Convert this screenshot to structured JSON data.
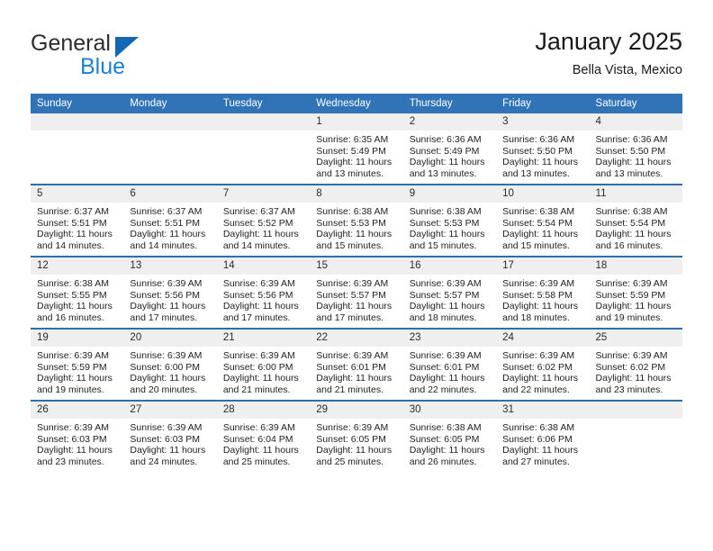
{
  "brand": {
    "name_top": "General",
    "name_bottom": "Blue",
    "triangle_color": "#1268b3",
    "blue_text_color": "#1c7fd4"
  },
  "header": {
    "title": "January 2025",
    "subtitle": "Bella Vista, Mexico"
  },
  "colors": {
    "header_row_bg": "#3073b6",
    "header_row_text": "#ffffff",
    "week_separator": "#2d6fae",
    "day_number_bg": "#efefef",
    "page_bg": "#ffffff"
  },
  "calendar": {
    "weekday_headers": [
      "Sunday",
      "Monday",
      "Tuesday",
      "Wednesday",
      "Thursday",
      "Friday",
      "Saturday"
    ],
    "weeks": [
      [
        {
          "day": "",
          "sunrise": "",
          "sunset": "",
          "daylight_line1": "",
          "daylight_line2": ""
        },
        {
          "day": "",
          "sunrise": "",
          "sunset": "",
          "daylight_line1": "",
          "daylight_line2": ""
        },
        {
          "day": "",
          "sunrise": "",
          "sunset": "",
          "daylight_line1": "",
          "daylight_line2": ""
        },
        {
          "day": "1",
          "sunrise": "Sunrise: 6:35 AM",
          "sunset": "Sunset: 5:49 PM",
          "daylight_line1": "Daylight: 11 hours",
          "daylight_line2": "and 13 minutes."
        },
        {
          "day": "2",
          "sunrise": "Sunrise: 6:36 AM",
          "sunset": "Sunset: 5:49 PM",
          "daylight_line1": "Daylight: 11 hours",
          "daylight_line2": "and 13 minutes."
        },
        {
          "day": "3",
          "sunrise": "Sunrise: 6:36 AM",
          "sunset": "Sunset: 5:50 PM",
          "daylight_line1": "Daylight: 11 hours",
          "daylight_line2": "and 13 minutes."
        },
        {
          "day": "4",
          "sunrise": "Sunrise: 6:36 AM",
          "sunset": "Sunset: 5:50 PM",
          "daylight_line1": "Daylight: 11 hours",
          "daylight_line2": "and 13 minutes."
        }
      ],
      [
        {
          "day": "5",
          "sunrise": "Sunrise: 6:37 AM",
          "sunset": "Sunset: 5:51 PM",
          "daylight_line1": "Daylight: 11 hours",
          "daylight_line2": "and 14 minutes."
        },
        {
          "day": "6",
          "sunrise": "Sunrise: 6:37 AM",
          "sunset": "Sunset: 5:51 PM",
          "daylight_line1": "Daylight: 11 hours",
          "daylight_line2": "and 14 minutes."
        },
        {
          "day": "7",
          "sunrise": "Sunrise: 6:37 AM",
          "sunset": "Sunset: 5:52 PM",
          "daylight_line1": "Daylight: 11 hours",
          "daylight_line2": "and 14 minutes."
        },
        {
          "day": "8",
          "sunrise": "Sunrise: 6:38 AM",
          "sunset": "Sunset: 5:53 PM",
          "daylight_line1": "Daylight: 11 hours",
          "daylight_line2": "and 15 minutes."
        },
        {
          "day": "9",
          "sunrise": "Sunrise: 6:38 AM",
          "sunset": "Sunset: 5:53 PM",
          "daylight_line1": "Daylight: 11 hours",
          "daylight_line2": "and 15 minutes."
        },
        {
          "day": "10",
          "sunrise": "Sunrise: 6:38 AM",
          "sunset": "Sunset: 5:54 PM",
          "daylight_line1": "Daylight: 11 hours",
          "daylight_line2": "and 15 minutes."
        },
        {
          "day": "11",
          "sunrise": "Sunrise: 6:38 AM",
          "sunset": "Sunset: 5:54 PM",
          "daylight_line1": "Daylight: 11 hours",
          "daylight_line2": "and 16 minutes."
        }
      ],
      [
        {
          "day": "12",
          "sunrise": "Sunrise: 6:38 AM",
          "sunset": "Sunset: 5:55 PM",
          "daylight_line1": "Daylight: 11 hours",
          "daylight_line2": "and 16 minutes."
        },
        {
          "day": "13",
          "sunrise": "Sunrise: 6:39 AM",
          "sunset": "Sunset: 5:56 PM",
          "daylight_line1": "Daylight: 11 hours",
          "daylight_line2": "and 17 minutes."
        },
        {
          "day": "14",
          "sunrise": "Sunrise: 6:39 AM",
          "sunset": "Sunset: 5:56 PM",
          "daylight_line1": "Daylight: 11 hours",
          "daylight_line2": "and 17 minutes."
        },
        {
          "day": "15",
          "sunrise": "Sunrise: 6:39 AM",
          "sunset": "Sunset: 5:57 PM",
          "daylight_line1": "Daylight: 11 hours",
          "daylight_line2": "and 17 minutes."
        },
        {
          "day": "16",
          "sunrise": "Sunrise: 6:39 AM",
          "sunset": "Sunset: 5:57 PM",
          "daylight_line1": "Daylight: 11 hours",
          "daylight_line2": "and 18 minutes."
        },
        {
          "day": "17",
          "sunrise": "Sunrise: 6:39 AM",
          "sunset": "Sunset: 5:58 PM",
          "daylight_line1": "Daylight: 11 hours",
          "daylight_line2": "and 18 minutes."
        },
        {
          "day": "18",
          "sunrise": "Sunrise: 6:39 AM",
          "sunset": "Sunset: 5:59 PM",
          "daylight_line1": "Daylight: 11 hours",
          "daylight_line2": "and 19 minutes."
        }
      ],
      [
        {
          "day": "19",
          "sunrise": "Sunrise: 6:39 AM",
          "sunset": "Sunset: 5:59 PM",
          "daylight_line1": "Daylight: 11 hours",
          "daylight_line2": "and 19 minutes."
        },
        {
          "day": "20",
          "sunrise": "Sunrise: 6:39 AM",
          "sunset": "Sunset: 6:00 PM",
          "daylight_line1": "Daylight: 11 hours",
          "daylight_line2": "and 20 minutes."
        },
        {
          "day": "21",
          "sunrise": "Sunrise: 6:39 AM",
          "sunset": "Sunset: 6:00 PM",
          "daylight_line1": "Daylight: 11 hours",
          "daylight_line2": "and 21 minutes."
        },
        {
          "day": "22",
          "sunrise": "Sunrise: 6:39 AM",
          "sunset": "Sunset: 6:01 PM",
          "daylight_line1": "Daylight: 11 hours",
          "daylight_line2": "and 21 minutes."
        },
        {
          "day": "23",
          "sunrise": "Sunrise: 6:39 AM",
          "sunset": "Sunset: 6:01 PM",
          "daylight_line1": "Daylight: 11 hours",
          "daylight_line2": "and 22 minutes."
        },
        {
          "day": "24",
          "sunrise": "Sunrise: 6:39 AM",
          "sunset": "Sunset: 6:02 PM",
          "daylight_line1": "Daylight: 11 hours",
          "daylight_line2": "and 22 minutes."
        },
        {
          "day": "25",
          "sunrise": "Sunrise: 6:39 AM",
          "sunset": "Sunset: 6:02 PM",
          "daylight_line1": "Daylight: 11 hours",
          "daylight_line2": "and 23 minutes."
        }
      ],
      [
        {
          "day": "26",
          "sunrise": "Sunrise: 6:39 AM",
          "sunset": "Sunset: 6:03 PM",
          "daylight_line1": "Daylight: 11 hours",
          "daylight_line2": "and 23 minutes."
        },
        {
          "day": "27",
          "sunrise": "Sunrise: 6:39 AM",
          "sunset": "Sunset: 6:03 PM",
          "daylight_line1": "Daylight: 11 hours",
          "daylight_line2": "and 24 minutes."
        },
        {
          "day": "28",
          "sunrise": "Sunrise: 6:39 AM",
          "sunset": "Sunset: 6:04 PM",
          "daylight_line1": "Daylight: 11 hours",
          "daylight_line2": "and 25 minutes."
        },
        {
          "day": "29",
          "sunrise": "Sunrise: 6:39 AM",
          "sunset": "Sunset: 6:05 PM",
          "daylight_line1": "Daylight: 11 hours",
          "daylight_line2": "and 25 minutes."
        },
        {
          "day": "30",
          "sunrise": "Sunrise: 6:38 AM",
          "sunset": "Sunset: 6:05 PM",
          "daylight_line1": "Daylight: 11 hours",
          "daylight_line2": "and 26 minutes."
        },
        {
          "day": "31",
          "sunrise": "Sunrise: 6:38 AM",
          "sunset": "Sunset: 6:06 PM",
          "daylight_line1": "Daylight: 11 hours",
          "daylight_line2": "and 27 minutes."
        },
        {
          "day": "",
          "sunrise": "",
          "sunset": "",
          "daylight_line1": "",
          "daylight_line2": ""
        }
      ]
    ]
  }
}
